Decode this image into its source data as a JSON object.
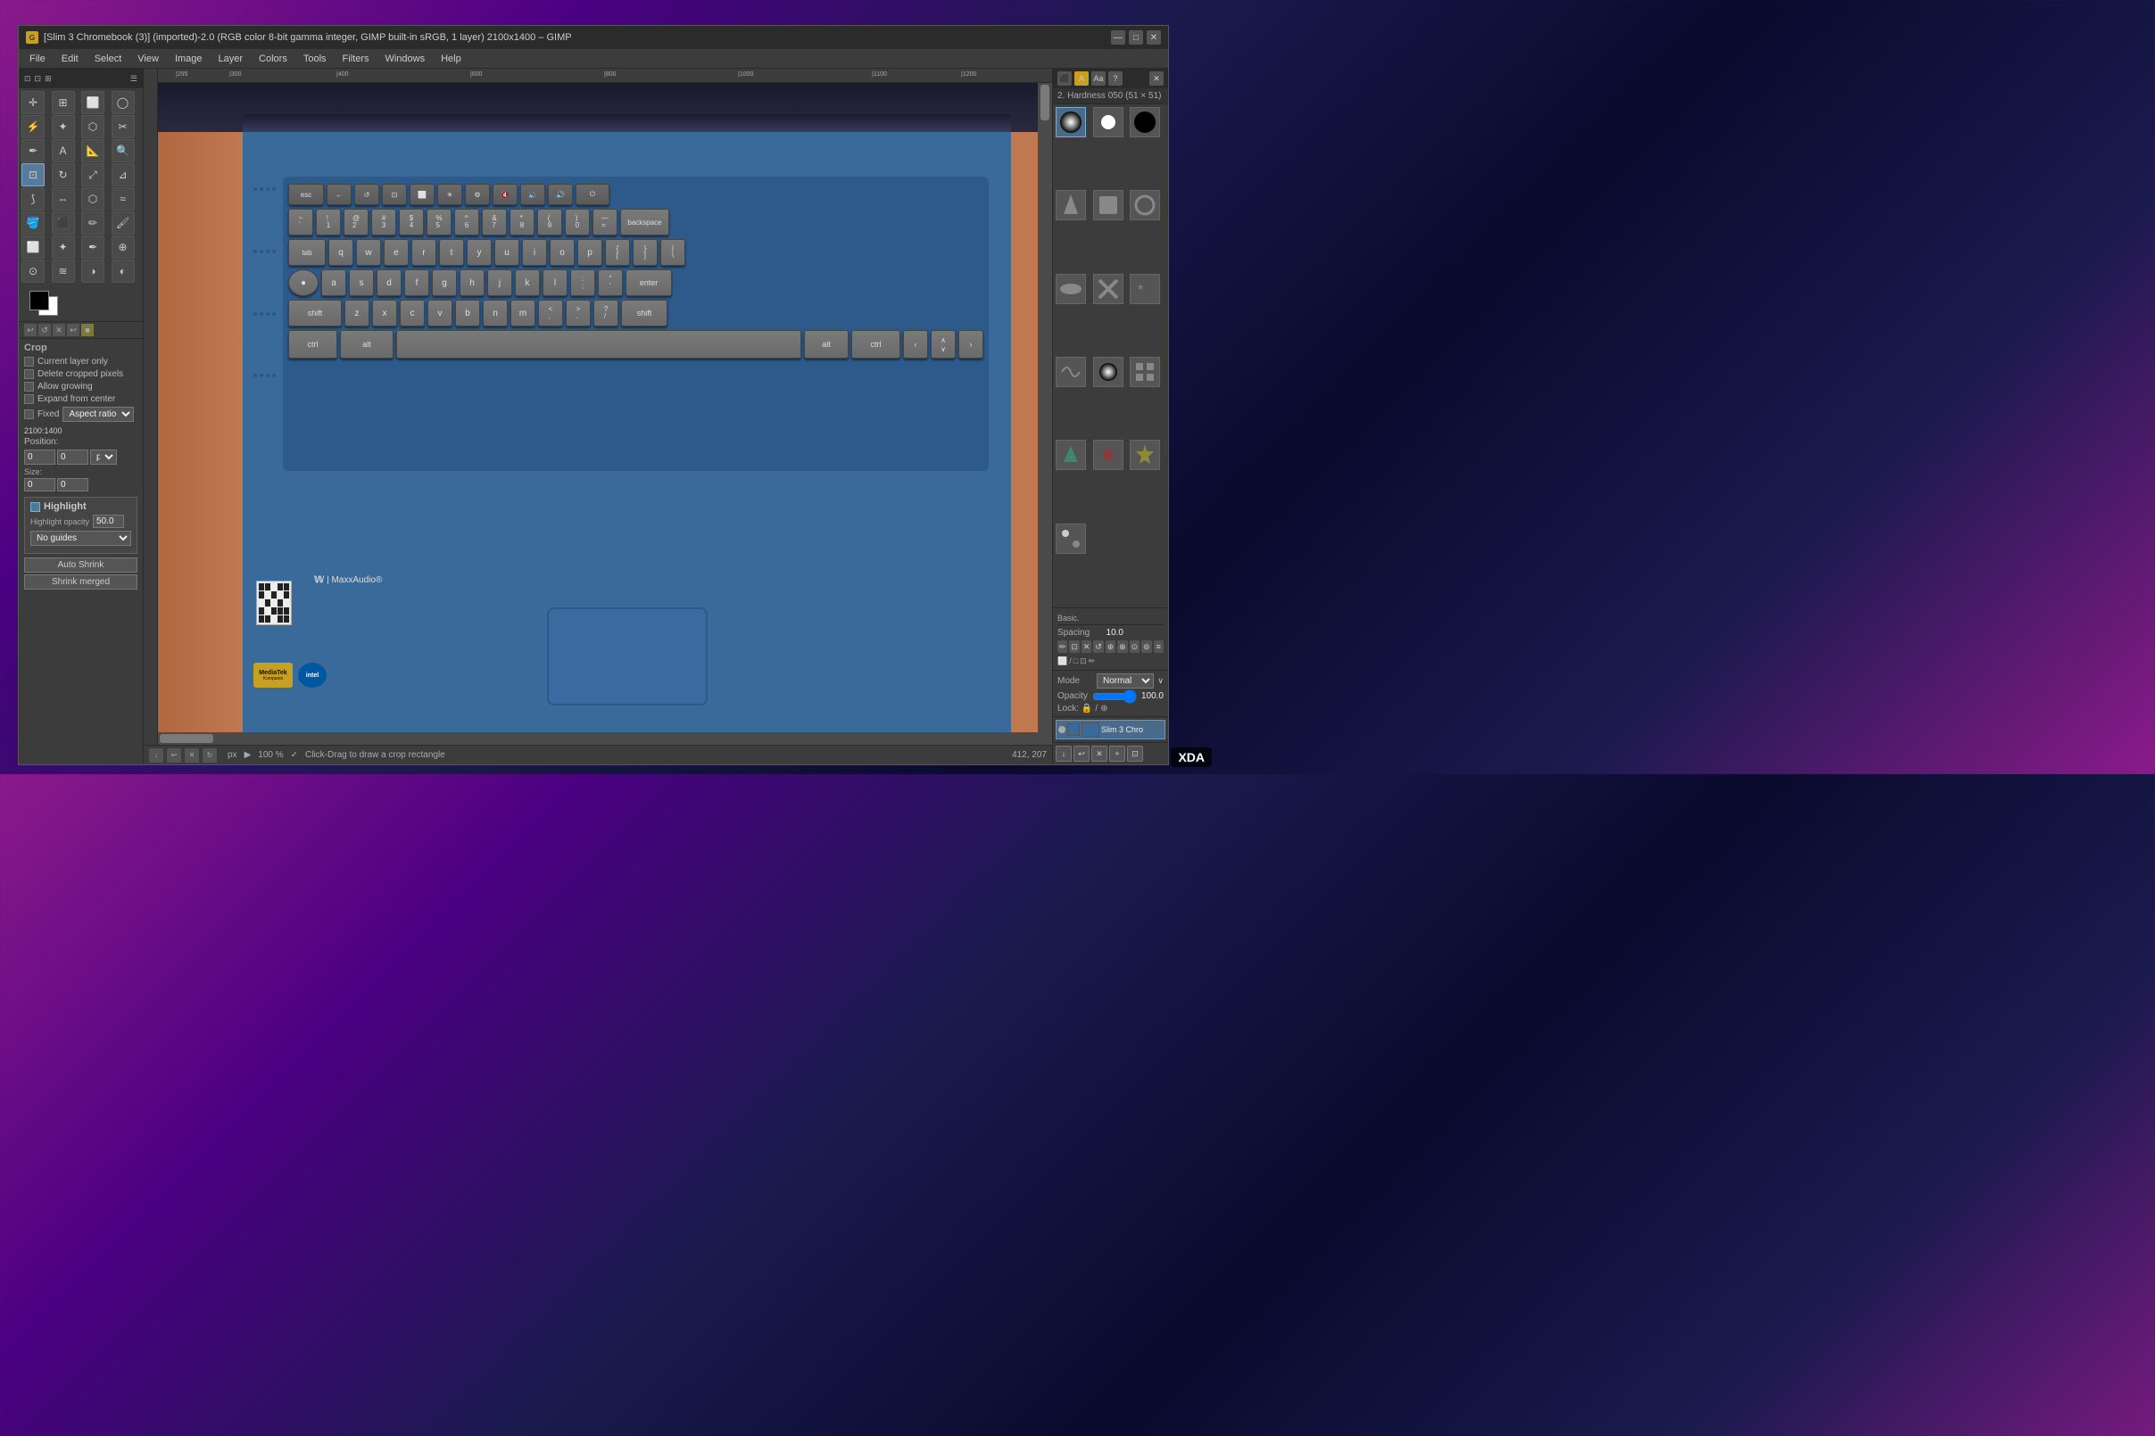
{
  "window": {
    "title": "[Slim 3 Chromebook (3)] (imported)-2.0 (RGB color 8-bit gamma integer, GIMP built-in sRGB, 1 layer) 2100x1400 – GIMP",
    "minimize_label": "—",
    "maximize_label": "□",
    "close_label": "✕"
  },
  "menu": {
    "items": [
      "File",
      "Edit",
      "Select",
      "View",
      "Image",
      "Layer",
      "Colors",
      "Tools",
      "Filters",
      "Windows",
      "Help"
    ]
  },
  "toolbox": {
    "tools": [
      {
        "name": "move",
        "icon": "✛"
      },
      {
        "name": "align",
        "icon": "⊞"
      },
      {
        "name": "select-rect",
        "icon": "⬜"
      },
      {
        "name": "select-ellipse",
        "icon": "◯"
      },
      {
        "name": "free-select",
        "icon": "⚡"
      },
      {
        "name": "fuzzy-select",
        "icon": "🔮"
      },
      {
        "name": "select-by-color",
        "icon": "🎨"
      },
      {
        "name": "scissors",
        "icon": "✂"
      },
      {
        "name": "paths",
        "icon": "✒"
      },
      {
        "name": "text",
        "icon": "A"
      },
      {
        "name": "measure",
        "icon": "📏"
      },
      {
        "name": "zoom",
        "icon": "🔍"
      },
      {
        "name": "crop",
        "icon": "⊡"
      },
      {
        "name": "rotate",
        "icon": "↻"
      },
      {
        "name": "scale",
        "icon": "⤢"
      },
      {
        "name": "shear",
        "icon": "⊿"
      }
    ]
  },
  "tool_options": {
    "title": "Crop",
    "current_layer_only_label": "Current layer only",
    "delete_cropped_pixels_label": "Delete cropped pixels",
    "allow_growing_label": "Allow growing",
    "expand_from_center_label": "Expand from center",
    "fixed_label": "Fixed",
    "aspect_ratio_label": "Aspect ratio",
    "size_label": "2100:1400",
    "position_label": "Position:",
    "pos_x": "0",
    "pos_y": "0",
    "pos_unit": "px",
    "size_w": "0",
    "size_h": "0"
  },
  "highlight": {
    "title": "Highlight",
    "opacity_label": "Highlight opacity",
    "opacity_value": "50.0",
    "guides_label": "No guides",
    "auto_shrink_label": "Auto Shrink",
    "shrink_merged_label": "Shrink merged"
  },
  "canvas": {
    "zoom": "100 %",
    "coords": "412, 207",
    "units": "px",
    "status_text": "Click-Drag to draw a crop rectangle"
  },
  "brushes": {
    "title": "2. Hardness 050 (51 × 51)"
  },
  "layers": {
    "mode_label": "Mode",
    "mode_value": "Normal",
    "opacity_label": "Opacity",
    "opacity_value": "100.0",
    "lock_label": "Lock:",
    "layer_name": "Slim 3 Chro"
  },
  "keyboard_keys": {
    "row1": [
      "esc",
      "←",
      "↺",
      "⊡",
      "⬜",
      "☀",
      "⚙",
      "🔇",
      "🔉",
      "🔊",
      "⏻"
    ],
    "row2": [
      "~\n`",
      "!\n1",
      "@\n2",
      "#\n3",
      "$\n4",
      "%\n5",
      "^\n6",
      "&\n7",
      "*\n8",
      "(\n9",
      ")\n0",
      "—\n=",
      "backspace"
    ],
    "row3": [
      "tab",
      "q",
      "w",
      "e",
      "r",
      "t",
      "y",
      "u",
      "i",
      "o",
      "p",
      "{\n[",
      "}\n]",
      "|\n\\"
    ],
    "row4": [
      "●",
      "a",
      "s",
      "d",
      "f",
      "g",
      "h",
      "j",
      "k",
      "l",
      ":\n;",
      "\"\n'",
      "enter"
    ],
    "row5": [
      "shift",
      "z",
      "x",
      "c",
      "v",
      "b",
      "n",
      "m",
      "<\n,",
      ">\n.",
      "?\n/",
      "shift"
    ],
    "row6": [
      "ctrl",
      "alt",
      "",
      "alt",
      "ctrl",
      "‹",
      "∧\n∨",
      "›"
    ]
  }
}
